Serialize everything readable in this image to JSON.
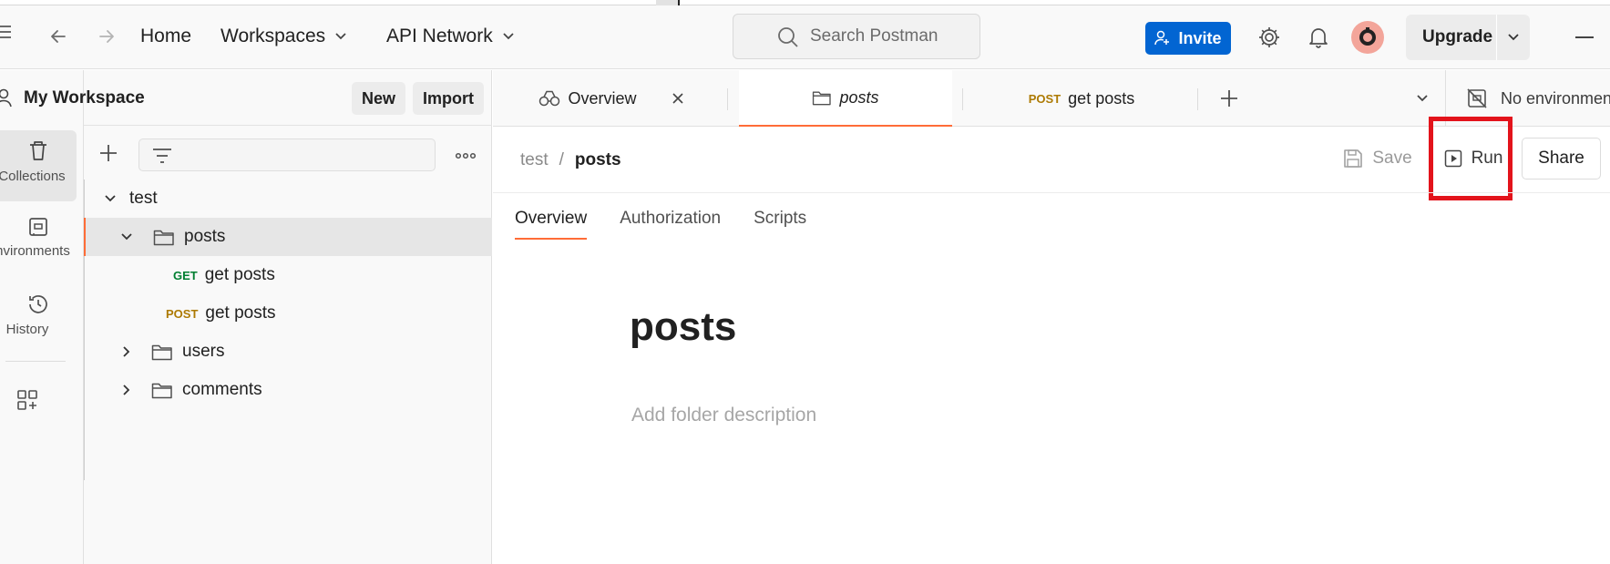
{
  "header": {
    "home": "Home",
    "workspaces": "Workspaces",
    "api_network": "API Network",
    "search_placeholder": "Search Postman",
    "invite": "Invite",
    "upgrade": "Upgrade"
  },
  "rail": {
    "collections": "Collections",
    "environments": "Environments",
    "history": "History"
  },
  "sidebar": {
    "workspace_name": "My Workspace",
    "new_btn": "New",
    "import_btn": "Import",
    "tree": [
      {
        "label": "test"
      },
      {
        "label": "posts"
      },
      {
        "method": "GET",
        "label": "get posts"
      },
      {
        "method": "POST",
        "label": "get posts"
      },
      {
        "label": "users"
      },
      {
        "label": "comments"
      }
    ]
  },
  "tabs": [
    {
      "label": "Overview"
    },
    {
      "label": "posts"
    },
    {
      "method": "POST",
      "label": "get posts"
    }
  ],
  "environment": "No environment",
  "main": {
    "breadcrumb": {
      "parent": "test",
      "separator": "/",
      "current": "posts"
    },
    "save": "Save",
    "run": "Run",
    "share": "Share",
    "subtabs": [
      "Overview",
      "Authorization",
      "Scripts"
    ],
    "folder_title": "posts",
    "folder_desc_placeholder": "Add folder description"
  },
  "colors": {
    "accent": "#ff6c37",
    "invite_blue": "#0265d2",
    "get_green": "#007f31",
    "post_amber": "#ad7a03",
    "highlight_red": "#e3131b"
  }
}
